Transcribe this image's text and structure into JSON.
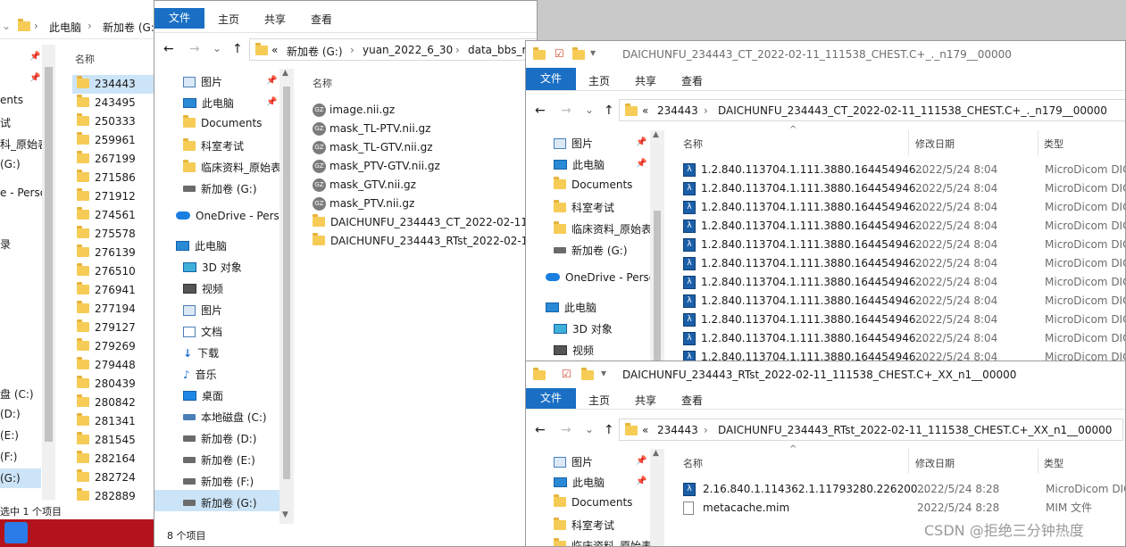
{
  "window1": {
    "breadcrumb": [
      "此电脑",
      "新加卷 (G:"
    ],
    "col_name": "名称",
    "folders": [
      "234443",
      "243495",
      "250333",
      "259961",
      "267199",
      "271586",
      "271912",
      "274561",
      "275578",
      "276139",
      "276510",
      "276941",
      "277194",
      "279127",
      "279269",
      "279448",
      "280439",
      "280842",
      "281341",
      "281545",
      "282164",
      "282724",
      "282889"
    ],
    "nav": [
      "ents",
      "试",
      "科_原始表",
      "(G:)",
      "e - Perso",
      "录",
      "盘 (C:)",
      "(D:)",
      "(E:)",
      "(F:)",
      "(G:)"
    ],
    "status": "选中 1 个项目"
  },
  "window2": {
    "tabs": {
      "file": "文件",
      "home": "主页",
      "share": "共享",
      "view": "查看"
    },
    "address": [
      "«",
      "新加卷 (G:)",
      "›",
      "yuan_2022_6_30",
      "›",
      "data_bbs_re"
    ],
    "nav": {
      "pictures": "图片",
      "thispc": "此电脑",
      "documents": "Documents",
      "dept_exam": "科室考试",
      "clinical": "临床资料_原始表",
      "newvol_g": "新加卷 (G:)",
      "onedrive": "OneDrive - Perso",
      "thispc2": "此电脑",
      "objects3d": "3D 对象",
      "videos": "视频",
      "pictures2": "图片",
      "docs": "文档",
      "downloads": "下载",
      "music": "音乐",
      "desktop": "桌面",
      "local_c": "本地磁盘 (C:)",
      "vol_d": "新加卷 (D:)",
      "vol_e": "新加卷 (E:)",
      "vol_f": "新加卷 (F:)",
      "vol_g": "新加卷 (G:)"
    },
    "col_name": "名称",
    "files": [
      {
        "name": "image.nii.gz",
        "type": "gz"
      },
      {
        "name": "mask_TL-PTV.nii.gz",
        "type": "gz"
      },
      {
        "name": "mask_TL-GTV.nii.gz",
        "type": "gz"
      },
      {
        "name": "mask_PTV-GTV.nii.gz",
        "type": "gz"
      },
      {
        "name": "mask_GTV.nii.gz",
        "type": "gz"
      },
      {
        "name": "mask_PTV.nii.gz",
        "type": "gz"
      },
      {
        "name": "DAICHUNFU_234443_CT_2022-02-11_",
        "type": "folder"
      },
      {
        "name": "DAICHUNFU_234443_RTst_2022-02-11_",
        "type": "folder"
      }
    ],
    "status": "8 个项目"
  },
  "window3": {
    "title": "DAICHUNFU_234443_CT_2022-02-11_111538_CHEST.C+_._n179__00000",
    "tabs": {
      "file": "文件",
      "home": "主页",
      "share": "共享",
      "view": "查看"
    },
    "address": [
      "«",
      "234443",
      "›",
      "DAICHUNFU_234443_CT_2022-02-11_111538_CHEST.C+_._n179__00000"
    ],
    "nav": {
      "pictures": "图片",
      "thispc": "此电脑",
      "documents": "Documents",
      "dept_exam": "科室考试",
      "clinical": "临床资料_原始表",
      "newvol_g": "新加卷 (G:)",
      "onedrive": "OneDrive - Perso",
      "thispc2": "此电脑",
      "objects3d": "3D 对象",
      "videos": "视频"
    },
    "columns": {
      "name": "名称",
      "modified": "修改日期",
      "type": "类型"
    },
    "rows": [
      {
        "name": "1.2.840.113704.1.111.3880.164454946...",
        "date": "2022/5/24 8:04",
        "type": "MicroDicom DIC"
      },
      {
        "name": "1.2.840.113704.1.111.3880.164454946...",
        "date": "2022/5/24 8:04",
        "type": "MicroDicom DIC"
      },
      {
        "name": "1.2.840.113704.1.111.3880.164454946...",
        "date": "2022/5/24 8:04",
        "type": "MicroDicom DIC"
      },
      {
        "name": "1.2.840.113704.1.111.3880.164454946...",
        "date": "2022/5/24 8:04",
        "type": "MicroDicom DIC"
      },
      {
        "name": "1.2.840.113704.1.111.3880.164454946...",
        "date": "2022/5/24 8:04",
        "type": "MicroDicom DIC"
      },
      {
        "name": "1.2.840.113704.1.111.3880.164454946...",
        "date": "2022/5/24 8:04",
        "type": "MicroDicom DIC"
      },
      {
        "name": "1.2.840.113704.1.111.3880.164454946...",
        "date": "2022/5/24 8:04",
        "type": "MicroDicom DIC"
      },
      {
        "name": "1.2.840.113704.1.111.3880.164454946...",
        "date": "2022/5/24 8:04",
        "type": "MicroDicom DIC"
      },
      {
        "name": "1.2.840.113704.1.111.3880.164454946...",
        "date": "2022/5/24 8:04",
        "type": "MicroDicom DIC"
      },
      {
        "name": "1.2.840.113704.1.111.3880.164454946...",
        "date": "2022/5/24 8:04",
        "type": "MicroDicom DIC"
      },
      {
        "name": "1.2.840.113704.1.111.3880.164454946...",
        "date": "2022/5/24 8:04",
        "type": "MicroDicom DIC"
      }
    ]
  },
  "window4": {
    "title": "DAICHUNFU_234443_RTst_2022-02-11_111538_CHEST.C+_XX_n1__00000",
    "tabs": {
      "file": "文件",
      "home": "主页",
      "share": "共享",
      "view": "查看"
    },
    "address": [
      "«",
      "234443",
      "›",
      "DAICHUNFU_234443_RTst_2022-02-11_111538_CHEST.C+_XX_n1__00000"
    ],
    "nav": {
      "pictures": "图片",
      "thispc": "此电脑",
      "documents": "Documents",
      "dept_exam": "科室考试",
      "clinical": "临床资料_原始表"
    },
    "columns": {
      "name": "名称",
      "modified": "修改日期",
      "type": "类型"
    },
    "rows": [
      {
        "name": "2.16.840.1.114362.1.11793280.226200...",
        "date": "2022/5/24 8:28",
        "type": "MicroDicom DIC",
        "icon": "dcm"
      },
      {
        "name": "metacache.mim",
        "date": "2022/5/24 8:28",
        "type": "MIM 文件",
        "icon": "file"
      }
    ]
  },
  "watermark": "CSDN @拒绝三分钟热度"
}
